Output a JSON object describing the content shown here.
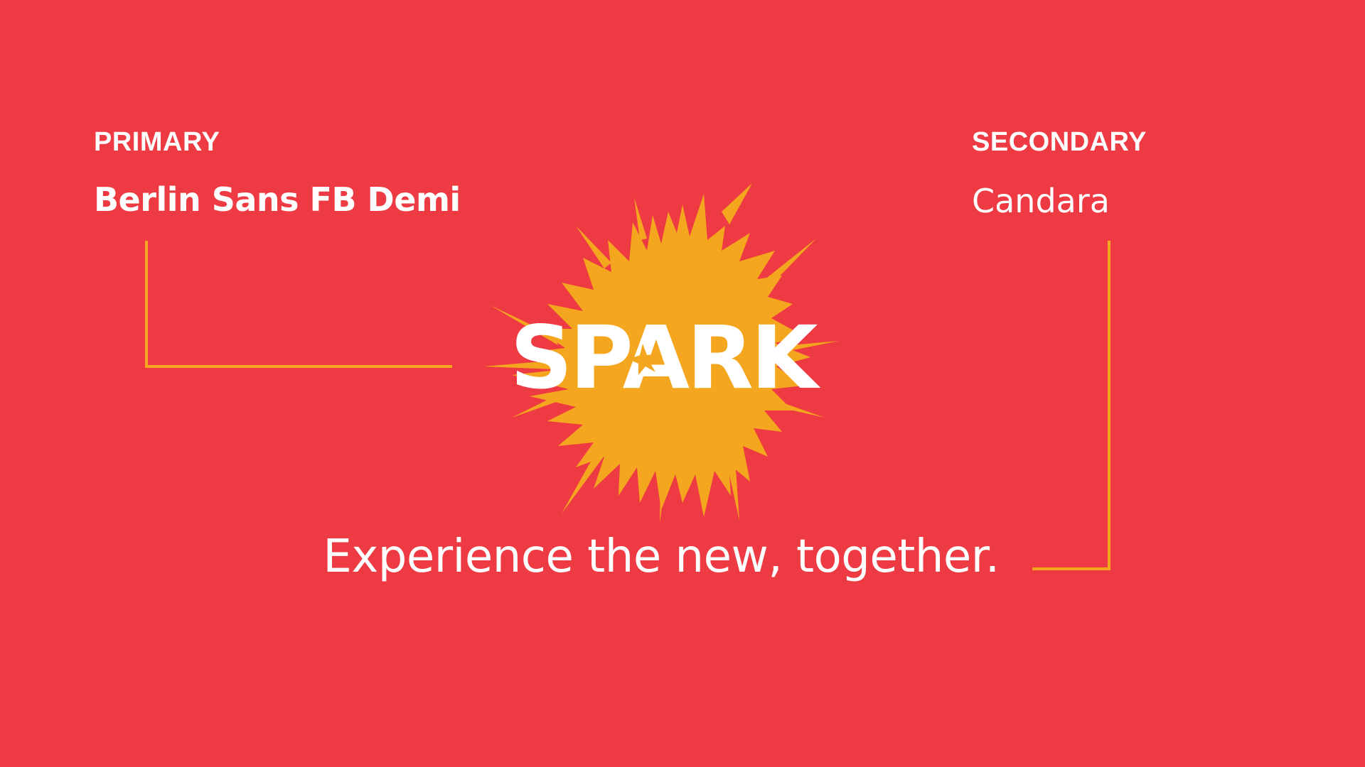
{
  "primary": {
    "label": "PRIMARY",
    "font_name": "Berlin Sans FB Demi"
  },
  "secondary": {
    "label": "SECONDARY",
    "font_name": "Candara"
  },
  "logo": {
    "wordmark": "SPARK"
  },
  "tagline": "Experience the new,  together.",
  "colors": {
    "background": "#ee3a43",
    "accent": "#f4a61e",
    "text": "#ffffff"
  }
}
